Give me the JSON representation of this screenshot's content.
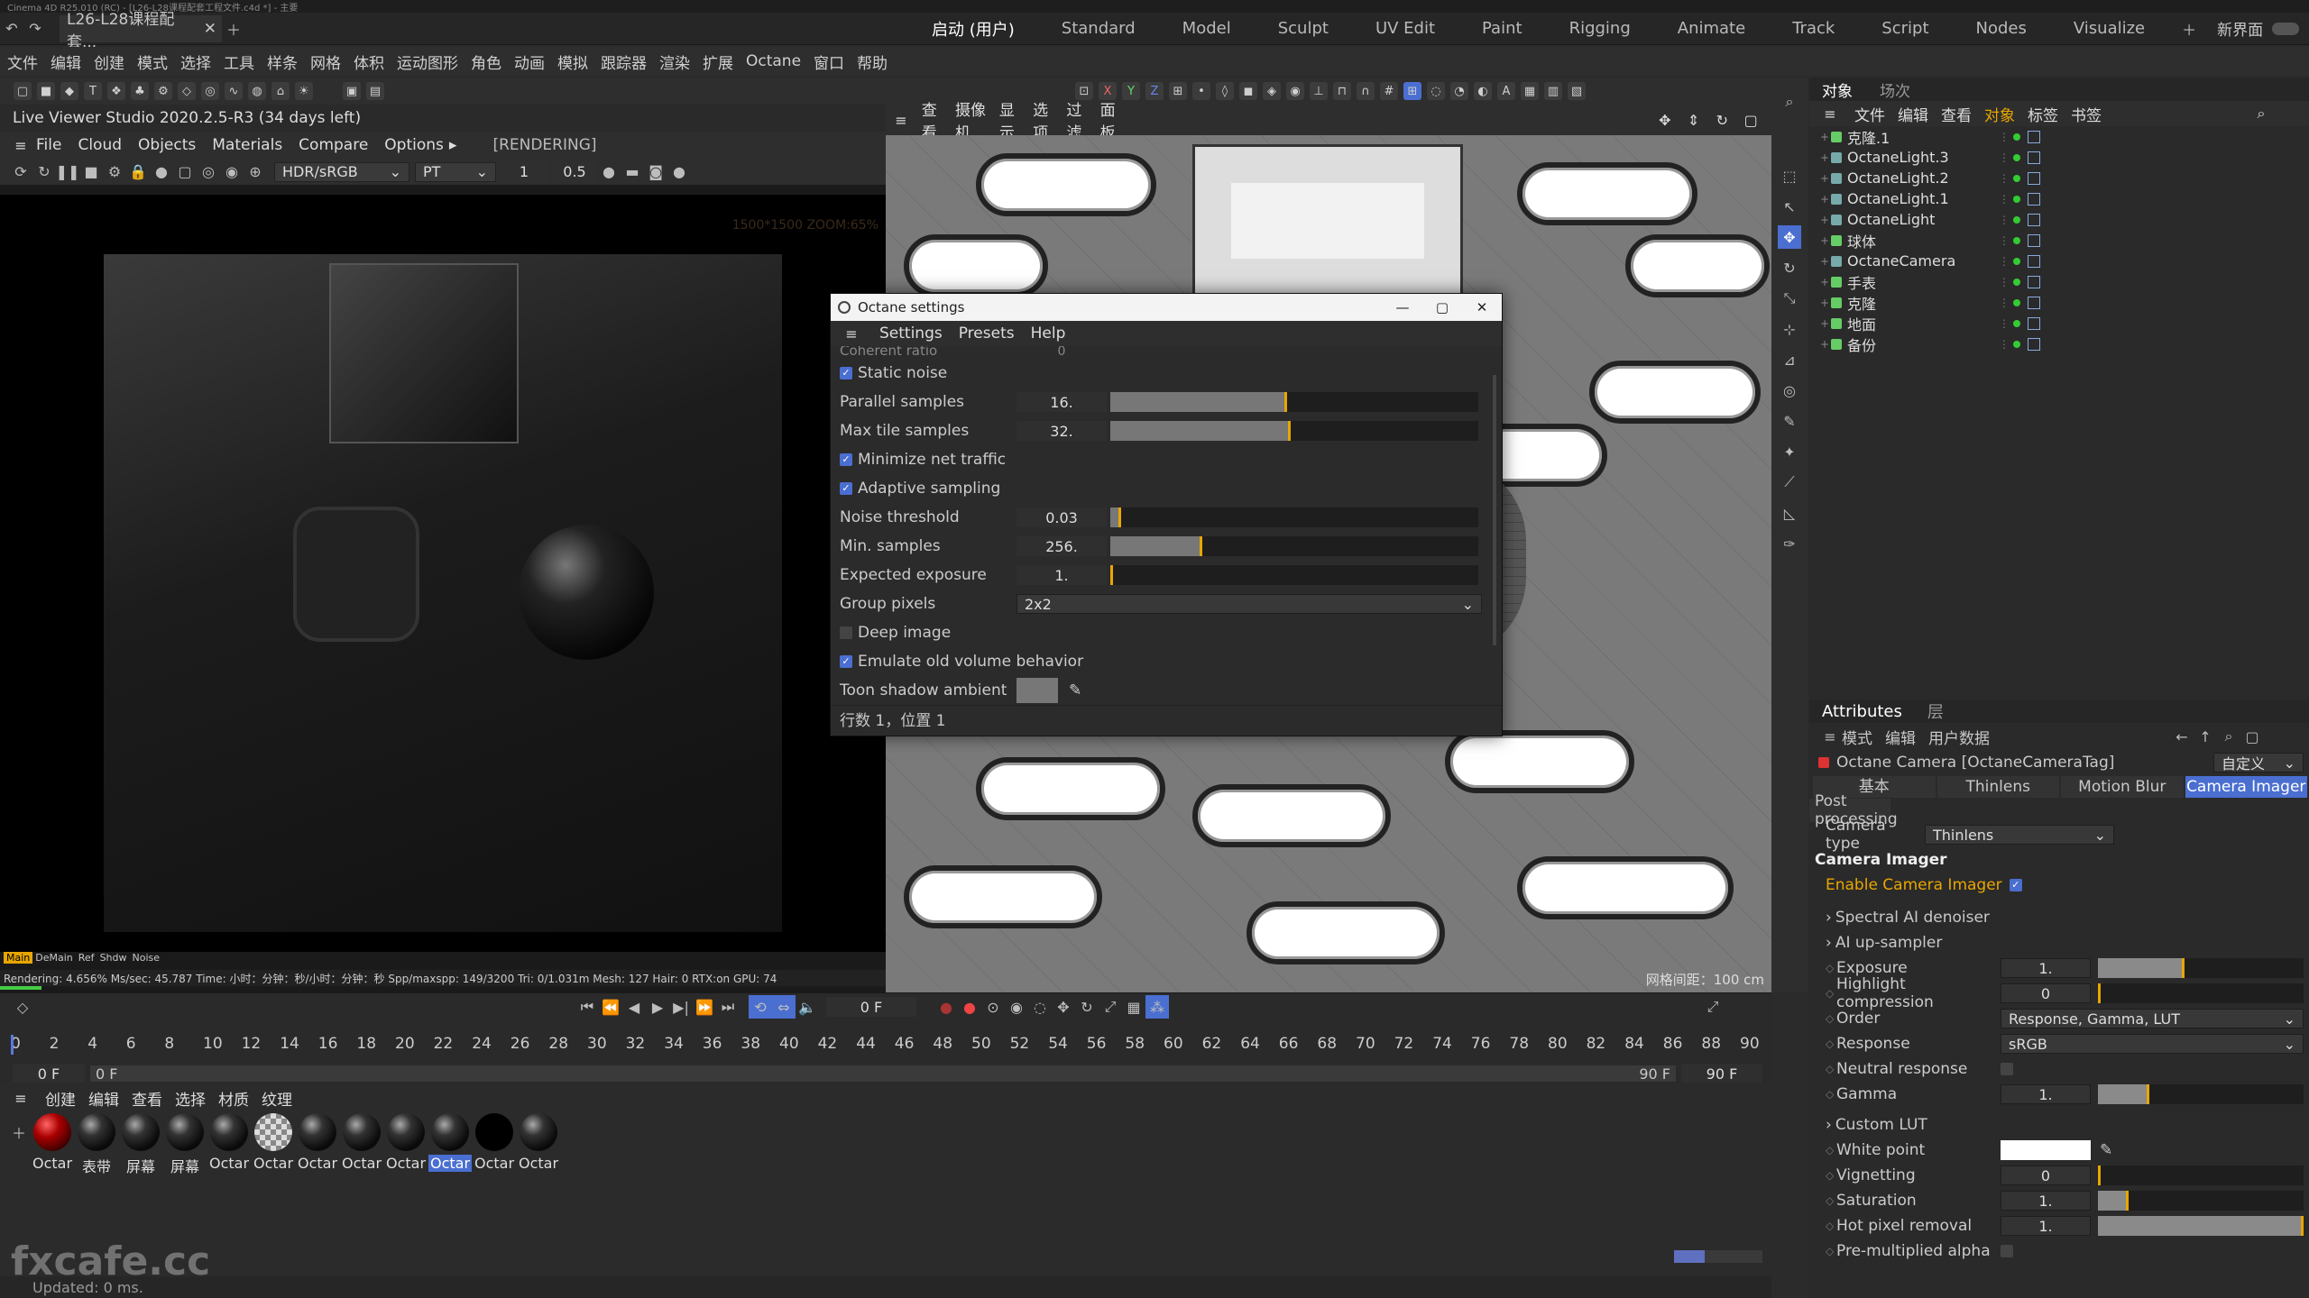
{
  "window_title": "Cinema 4D R25.010 (RC) - [L26-L28课程配套工程文件.c4d *] - 主要",
  "doc_tab": "L26-L28课程配套...",
  "layouts": [
    "启动 (用户)",
    "Standard",
    "Model",
    "Sculpt",
    "UV Edit",
    "Paint",
    "Rigging",
    "Animate",
    "Track",
    "Script",
    "Nodes",
    "Visualize"
  ],
  "new_layout": "新界面",
  "main_menu": [
    "文件",
    "编辑",
    "创建",
    "模式",
    "选择",
    "工具",
    "样条",
    "网格",
    "体积",
    "运动图形",
    "角色",
    "动画",
    "模拟",
    "跟踪器",
    "渲染",
    "扩展",
    "Octane",
    "窗口",
    "帮助"
  ],
  "live_viewer": {
    "title": "Live Viewer Studio 2020.2.5-R3 (34 days left)",
    "menu": [
      "File",
      "Cloud",
      "Objects",
      "Materials",
      "Compare",
      "Options"
    ],
    "menu_more": "▸",
    "state": "[RENDERING]",
    "colorspace": "HDR/sRGB",
    "kernel": "PT",
    "val1": "1",
    "val2": "0.5",
    "zoom_info": "1500*1500 ZOOM:65%",
    "tags": [
      "Main",
      "DeMain",
      "Ref",
      "Shdw",
      "Noise"
    ],
    "status": "Rendering: 4.656% Ms/sec: 45.787  Time: 小时：分钟：秒/小时：分钟：秒  Spp/maxspp: 149/3200  Tri: 0/1.031m Mesh: 127 Hair: 0  RTX:on   GPU: 74"
  },
  "viewport": {
    "menu": [
      "查看",
      "摄像机",
      "显示",
      "选项",
      "过滤",
      "面板"
    ],
    "grid_label": "网格间距：100 cm"
  },
  "octane_settings": {
    "title": "Octane settings",
    "menu": [
      "Settings",
      "Presets",
      "Help"
    ],
    "partial_label": "Coherent ratio",
    "partial_value": "0",
    "rows": [
      {
        "type": "check",
        "label": "Static noise",
        "checked": true
      },
      {
        "type": "num",
        "label": "Parallel samples",
        "value": "16.",
        "fill": 0.48
      },
      {
        "type": "num",
        "label": "Max tile samples",
        "value": "32.",
        "fill": 0.49
      },
      {
        "type": "check",
        "label": "Minimize net traffic",
        "checked": true
      },
      {
        "type": "check",
        "label": "Adaptive sampling",
        "checked": true
      },
      {
        "type": "num",
        "label": "Noise threshold",
        "value": "0.03",
        "fill": 0.03
      },
      {
        "type": "num",
        "label": "Min. samples",
        "value": "256.",
        "fill": 0.25
      },
      {
        "type": "num",
        "label": "Expected exposure",
        "value": "1.",
        "fill": 0.0
      },
      {
        "type": "dd",
        "label": "Group pixels",
        "value": "2x2"
      },
      {
        "type": "check",
        "label": "Deep image",
        "checked": false
      },
      {
        "type": "check",
        "label": "Emulate old volume behavior",
        "checked": true
      },
      {
        "type": "color",
        "label": "Toon shadow ambient"
      }
    ],
    "footer": "行数 1，位置 1"
  },
  "object_manager": {
    "tabs": [
      "对象",
      "场次"
    ],
    "menu": [
      "文件",
      "编辑",
      "查看",
      "对象",
      "标签",
      "书签"
    ],
    "objects": [
      "克隆.1",
      "OctaneLight.3",
      "OctaneLight.2",
      "OctaneLight.1",
      "OctaneLight",
      "球体",
      "OctaneCamera",
      "手表",
      "克隆",
      "地面",
      "备份"
    ]
  },
  "attributes": {
    "tabs": [
      "Attributes",
      "层"
    ],
    "menu": [
      "模式",
      "编辑",
      "用户数据"
    ],
    "object": "Octane Camera [OctaneCameraTag]",
    "preset": "自定义",
    "subtabs": [
      "基本",
      "Thinlens",
      "Motion Blur",
      "Camera Imager"
    ],
    "post_processing": "Post processing",
    "camera_type_label": "Camera type",
    "camera_type": "Thinlens",
    "section": "Camera Imager",
    "enable_label": "Enable Camera Imager",
    "spectral": "Spectral AI denoiser",
    "upsampler": "AI up-sampler",
    "exposure": {
      "label": "Exposure",
      "value": "1.",
      "fill": 0.42
    },
    "highlight": {
      "label": "Highlight compression",
      "value": "0",
      "fill": 0.0
    },
    "order": {
      "label": "Order",
      "value": "Response, Gamma, LUT"
    },
    "response": {
      "label": "Response",
      "value": "sRGB"
    },
    "neutral": {
      "label": "Neutral response"
    },
    "gamma": {
      "label": "Gamma",
      "value": "1.",
      "fill": 0.25
    },
    "custom_lut": "Custom LUT",
    "white_point": {
      "label": "White point"
    },
    "vignetting": {
      "label": "Vignetting",
      "value": "0",
      "fill": 0.0
    },
    "saturation": {
      "label": "Saturation",
      "value": "1.",
      "fill": 0.15
    },
    "hot_pixel": {
      "label": "Hot pixel removal",
      "value": "1.",
      "fill": 1.0
    },
    "premult": {
      "label": "Pre-multiplied alpha"
    }
  },
  "timeline": {
    "current_frame": "0 F",
    "ruler": [
      "0",
      "2",
      "4",
      "6",
      "8",
      "10",
      "12",
      "14",
      "16",
      "18",
      "20",
      "22",
      "24",
      "26",
      "28",
      "30",
      "32",
      "34",
      "36",
      "38",
      "40",
      "42",
      "44",
      "46",
      "48",
      "50",
      "52",
      "54",
      "56",
      "58",
      "60",
      "62",
      "64",
      "66",
      "68",
      "70",
      "72",
      "74",
      "76",
      "78",
      "80",
      "82",
      "84",
      "86",
      "88",
      "90"
    ],
    "start_a": "0 F",
    "start_b": "0 F",
    "end_a": "90 F",
    "end_b": "90 F"
  },
  "material_manager": {
    "menu": [
      "创建",
      "编辑",
      "查看",
      "选择",
      "材质",
      "纹理"
    ],
    "materials": [
      "Octar",
      "表带",
      "屏幕",
      "屏幕",
      "Octar",
      "Octar",
      "Octar",
      "Octar",
      "Octar",
      "Octar",
      "Octar",
      "Octar"
    ],
    "selected_index": 9
  },
  "status_bar": "Updated: 0 ms.",
  "watermark": "fxcafe.cc"
}
